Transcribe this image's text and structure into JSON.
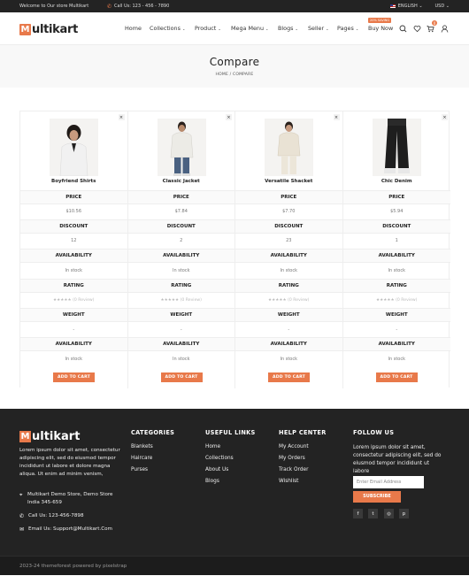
{
  "topbar": {
    "welcome": "Welcome to Our store Multikart",
    "call": "Call Us: 123 - 456 - 7890",
    "language": "ENGLISH",
    "currency": "USD"
  },
  "header": {
    "logo_m": "M",
    "logo_rest": "ultikart",
    "nav": [
      "Home",
      "Collections",
      "Product",
      "Mega Menu",
      "Blogs",
      "Seller",
      "Pages",
      "Buy Now"
    ],
    "hot_badge": "20% SAVING",
    "cart_count": "0"
  },
  "banner": {
    "title": "Compare",
    "crumb_home": "HOME",
    "crumb_sep": "/",
    "crumb_current": "COMPARE"
  },
  "compare": {
    "remove": "×",
    "labels": {
      "price": "PRICE",
      "discount": "DISCOUNT",
      "availability": "AVAILABILITY",
      "rating": "RATING",
      "weight": "WEIGHT"
    },
    "add_to_cart": "ADD TO CART",
    "products": [
      {
        "name": "Boyfriend Shirts",
        "price": "$10.56",
        "discount": "12",
        "availability": "In stock",
        "rating": "★★★★★ (0 Review)",
        "weight": "-",
        "availability2": "In stock"
      },
      {
        "name": "Classic Jacket",
        "price": "$7.84",
        "discount": "2",
        "availability": "In stock",
        "rating": "★★★★★ (0 Review)",
        "weight": "-",
        "availability2": "In stock"
      },
      {
        "name": "Versatile Shacket",
        "price": "$7.70",
        "discount": "23",
        "availability": "In stock",
        "rating": "★★★★★ (0 Review)",
        "weight": "-",
        "availability2": "In stock"
      },
      {
        "name": "Chic Denim",
        "price": "$5.94",
        "discount": "1",
        "availability": "In stock",
        "rating": "★★★★★ (0 Review)",
        "weight": "-",
        "availability2": "In stock"
      }
    ]
  },
  "footer": {
    "logo_m": "M",
    "logo_rest": "ultikart",
    "about": "Lorem ipsum dolor sit amet, consectetur adipiscing elit, sed do eiusmod tempor incididunt ut labore et dolore magna aliqua. Ut enim ad minim venism,",
    "address": "Multikart Demo Store, Demo Store India 345-659",
    "phone": "Call Us: 123-456-7898",
    "email": "Email Us: Support@Multikart.Com",
    "categories": {
      "title": "CATEGORIES",
      "items": [
        "Blankets",
        "Haircare",
        "Purses"
      ]
    },
    "useful_links": {
      "title": "USEFUL LINKS",
      "items": [
        "Home",
        "Collections",
        "About Us",
        "Blogs"
      ]
    },
    "help_center": {
      "title": "HELP CENTER",
      "items": [
        "My Account",
        "My Orders",
        "Track Order",
        "Wishlist"
      ]
    },
    "follow": {
      "title": "FOLLOW US",
      "text": "Lorem ipsum dolor sit amet, consectetur adipiscing elit, sed do eiusmod tempor incididunt ut labore",
      "email_placeholder": "Enter Email Address",
      "subscribe": "SUBSCRIBE"
    },
    "copyright": "2023-24 themeforest powered by pixelstrap"
  },
  "colors": {
    "accent": "#e8794a",
    "dark": "#232323"
  }
}
